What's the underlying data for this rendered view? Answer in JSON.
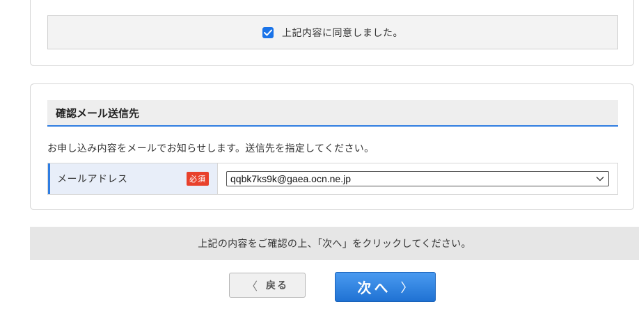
{
  "consent": {
    "checked": true,
    "label": "上記内容に同意しました。"
  },
  "email_section": {
    "title": "確認メール送信先",
    "description": "お申し込み内容をメールでお知らせします。送信先を指定してください。",
    "field_label": "メールアドレス",
    "required_badge": "必須",
    "selected_email": "qqbk7ks9k@gaea.ocn.ne.jp"
  },
  "notice": {
    "text": "上記の内容をご確認の上、「次へ」をクリックしてください。"
  },
  "buttons": {
    "back_arrow": "〈",
    "back_label": "戻る",
    "next_label": "次へ",
    "next_arrow": "〉"
  },
  "colors": {
    "accent_blue": "#2f7de1",
    "required_red": "#e8412c",
    "next_button": "#1f72d3"
  }
}
